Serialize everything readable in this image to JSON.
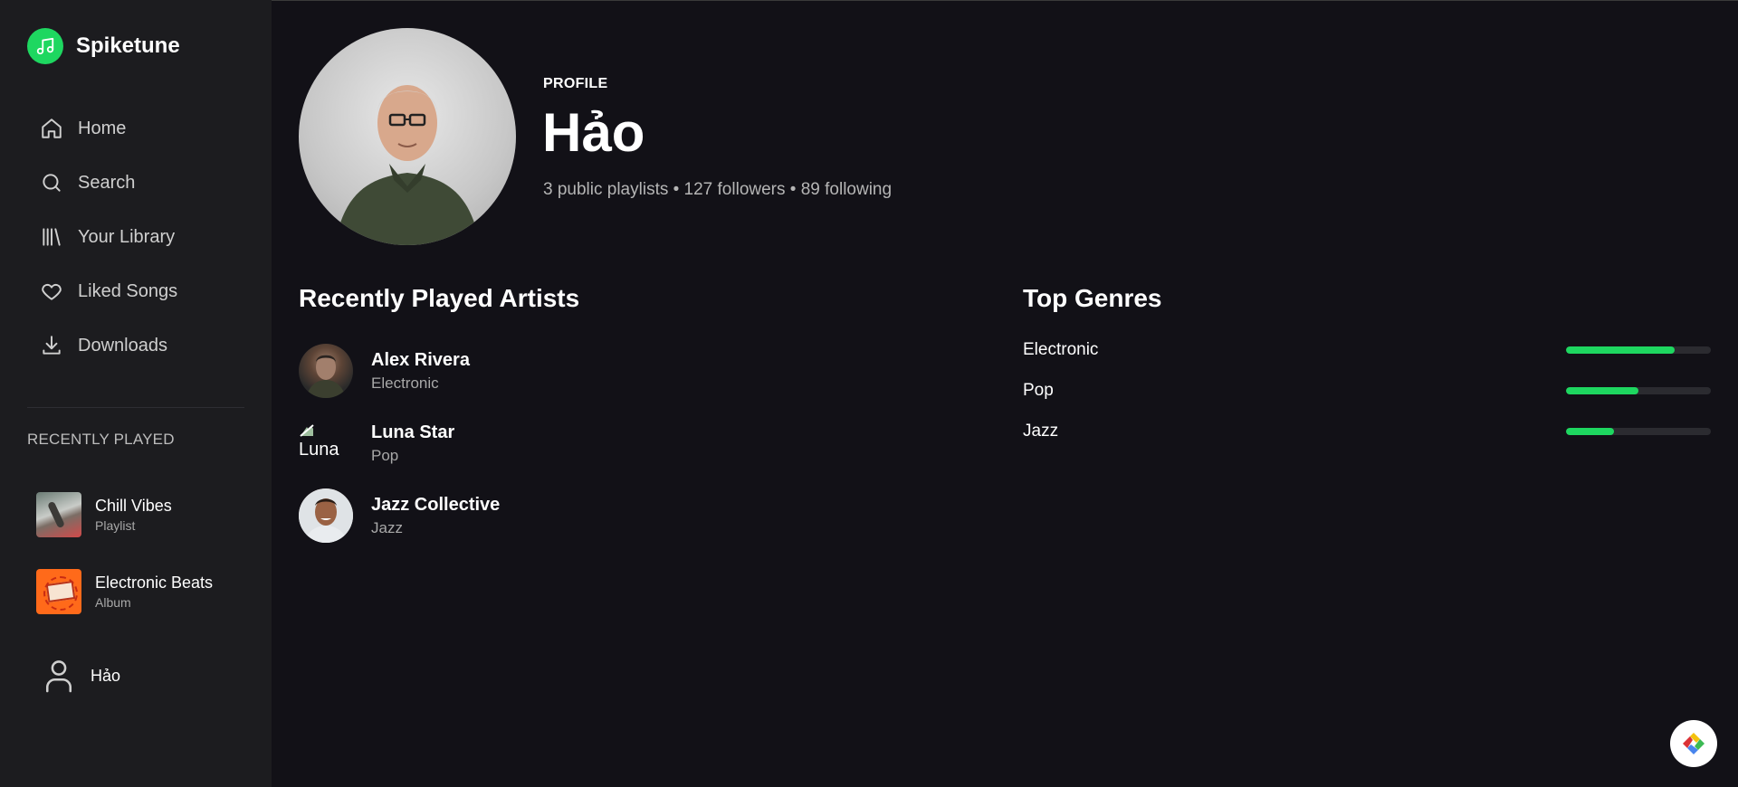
{
  "app": {
    "name": "Spiketune",
    "accent": "#1ed760"
  },
  "nav": {
    "items": [
      {
        "label": "Home",
        "icon": "home-icon"
      },
      {
        "label": "Search",
        "icon": "search-icon"
      },
      {
        "label": "Your Library",
        "icon": "library-icon"
      },
      {
        "label": "Liked Songs",
        "icon": "heart-icon"
      },
      {
        "label": "Downloads",
        "icon": "download-icon"
      }
    ]
  },
  "recently_played": {
    "title": "RECENTLY PLAYED",
    "items": [
      {
        "title": "Chill Vibes",
        "type": "Playlist"
      },
      {
        "title": "Electronic Beats",
        "type": "Album"
      }
    ]
  },
  "user": {
    "name": "Hảo"
  },
  "profile": {
    "label": "PROFILE",
    "name": "Hảo",
    "stats": "3 public playlists • 127 followers • 89 following"
  },
  "recent_artists": {
    "title": "Recently Played Artists",
    "items": [
      {
        "name": "Alex Rivera",
        "genre": "Electronic"
      },
      {
        "name": "Luna Star",
        "genre": "Pop",
        "image_alt": "Luna"
      },
      {
        "name": "Jazz Collective",
        "genre": "Jazz"
      }
    ]
  },
  "top_genres": {
    "title": "Top Genres",
    "items": [
      {
        "name": "Electronic",
        "share": 0.75
      },
      {
        "name": "Pop",
        "share": 0.5
      },
      {
        "name": "Jazz",
        "share": 0.33
      }
    ]
  }
}
